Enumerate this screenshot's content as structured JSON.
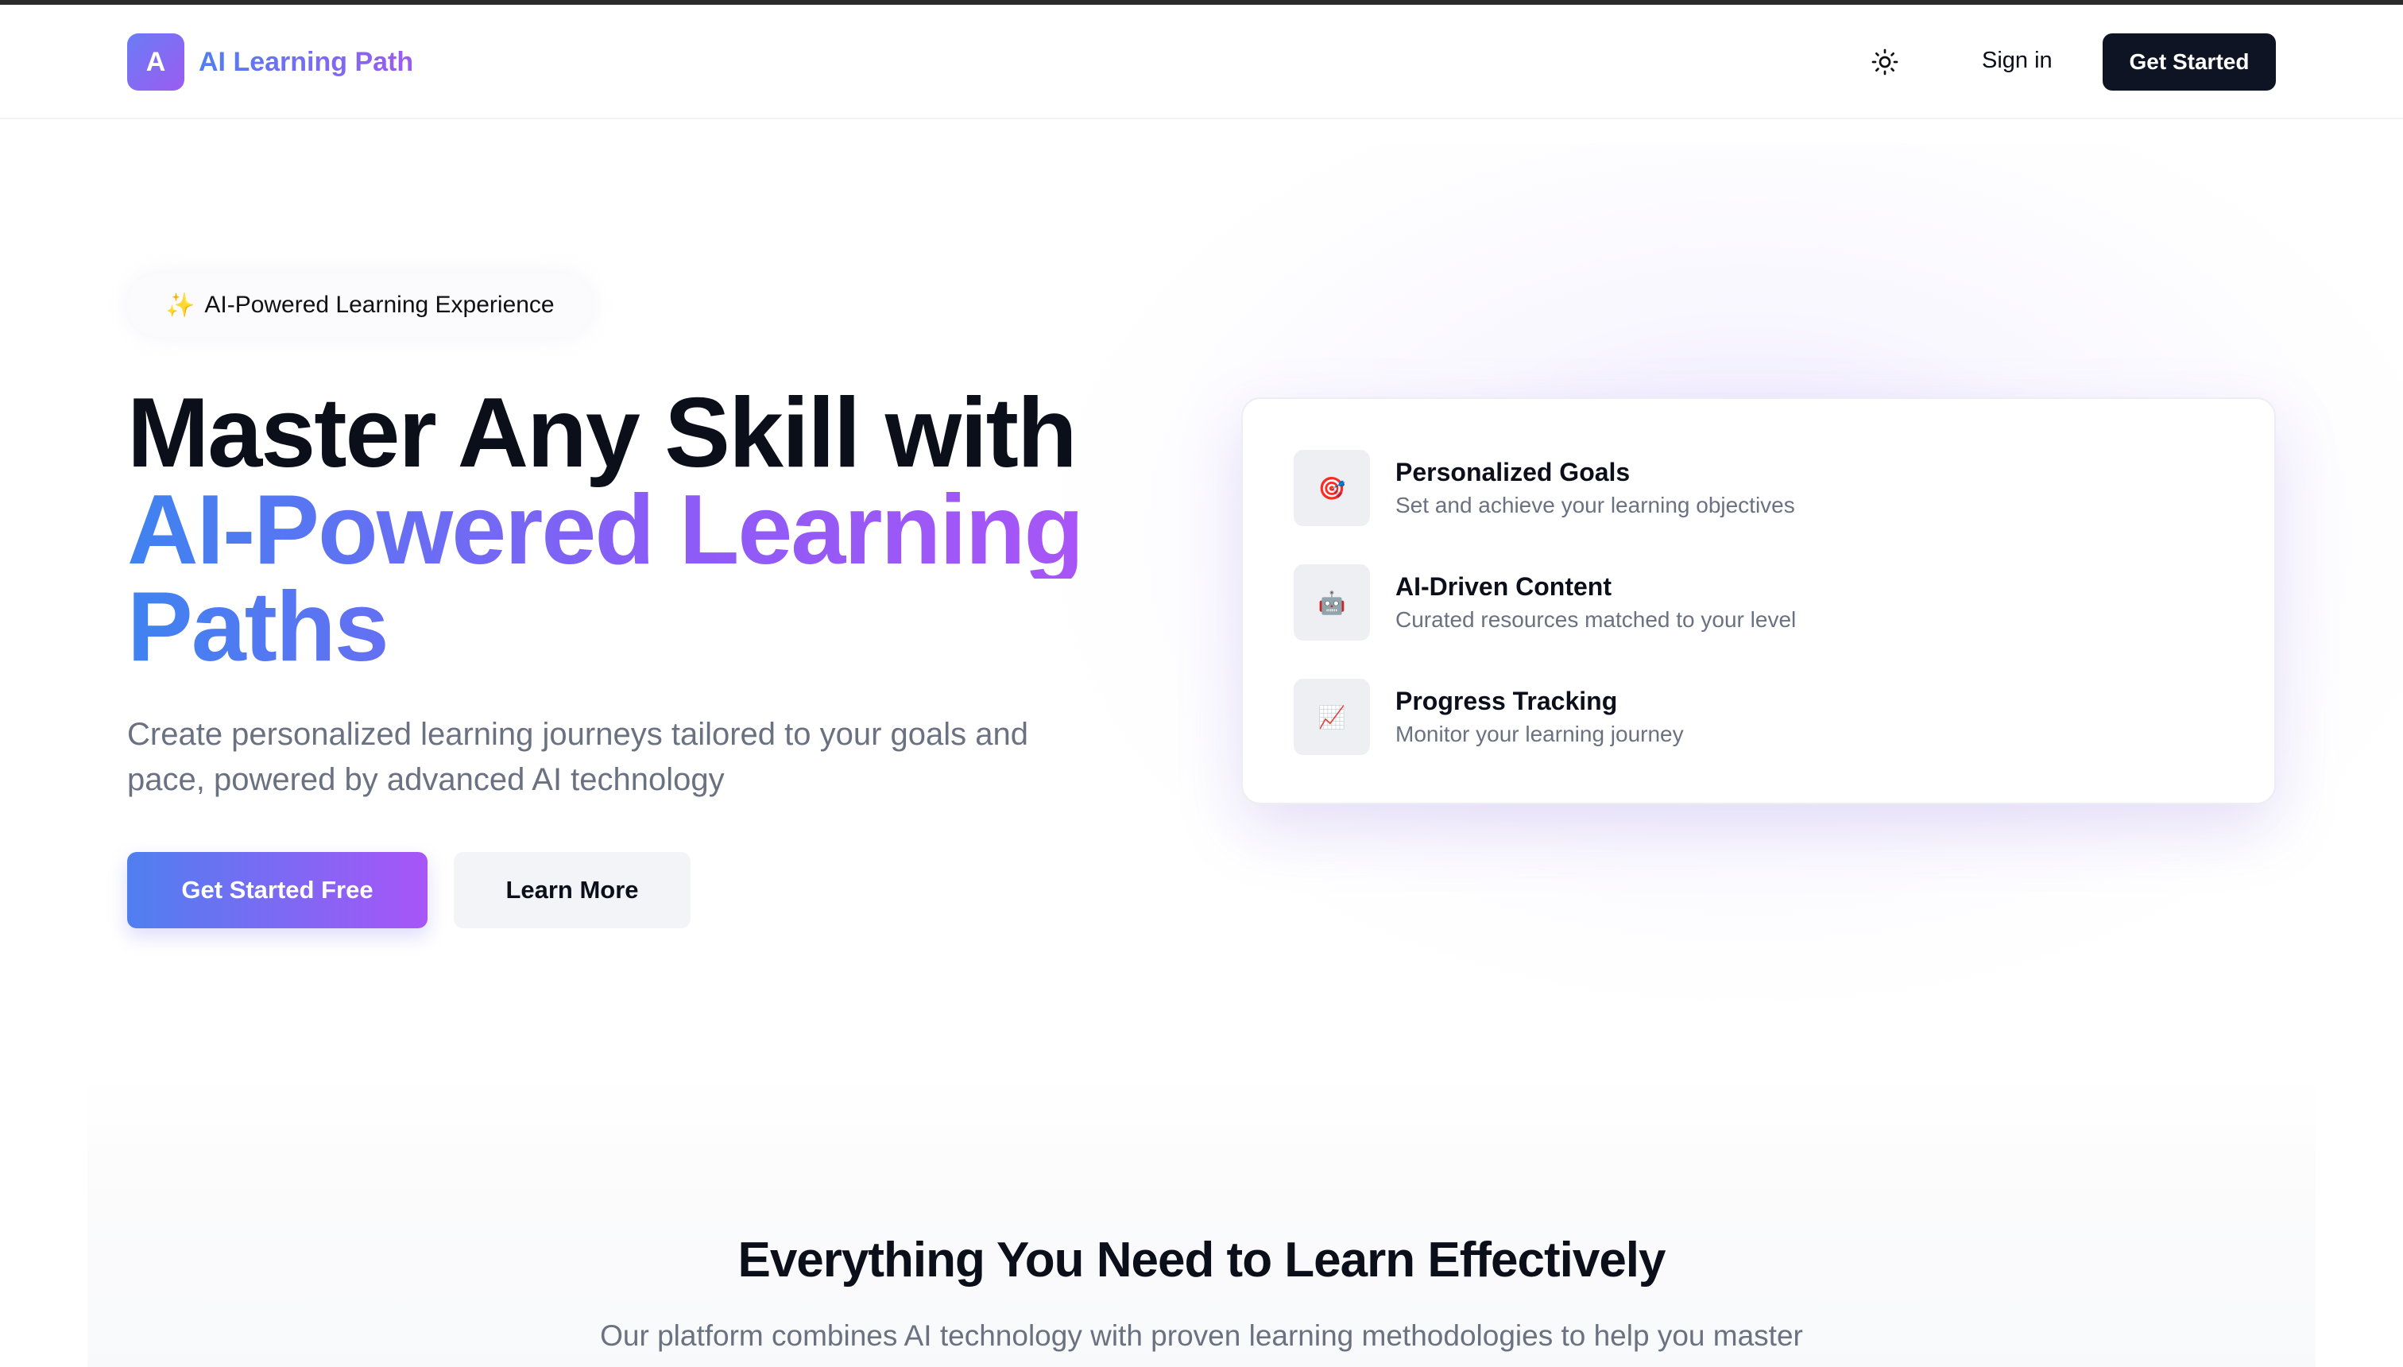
{
  "header": {
    "logo_letter": "A",
    "brand": "AI Learning Path",
    "theme_icon": "sun-icon",
    "sign_in": "Sign in",
    "get_started": "Get Started"
  },
  "hero": {
    "badge_icon": "✨",
    "badge_text": "AI-Powered Learning Experience",
    "title_line1": "Master Any Skill with",
    "title_line2": "AI-Powered Learning",
    "title_line3": "Paths",
    "description": "Create personalized learning journeys tailored to your goals and pace, powered by advanced AI technology",
    "primary_button": "Get Started Free",
    "secondary_button": "Learn More"
  },
  "features_card": {
    "items": [
      {
        "icon": "🎯",
        "icon_name": "target-icon",
        "title": "Personalized Goals",
        "description": "Set and achieve your learning objectives"
      },
      {
        "icon": "🤖",
        "icon_name": "robot-icon",
        "title": "AI-Driven Content",
        "description": "Curated resources matched to your level"
      },
      {
        "icon": "📈",
        "icon_name": "chart-icon",
        "title": "Progress Tracking",
        "description": "Monitor your learning journey"
      }
    ]
  },
  "section2": {
    "title": "Everything You Need to Learn Effectively",
    "subtitle": "Our platform combines AI technology with proven learning methodologies to help you master"
  },
  "colors": {
    "primary_start": "#4f7ff0",
    "primary_end": "#a855f7",
    "dark_button": "#0e1424",
    "muted_text": "#6a7181"
  }
}
